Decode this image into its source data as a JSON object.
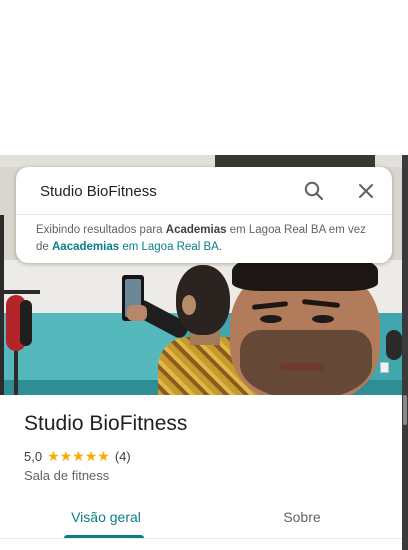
{
  "search": {
    "query": "Studio BioFitness"
  },
  "notice": {
    "prefix": "Exibindo resultados para ",
    "corrected_term": "Academias",
    "middle": " em Lagoa Real BA em vez de ",
    "original_term": "Aacademias",
    "original_suffix": " em Lagoa Real BA",
    "end": "."
  },
  "place": {
    "name": "Studio BioFitness",
    "rating": "5,0",
    "stars": "★★★★★",
    "review_count": "(4)",
    "category": "Sala de fitness"
  },
  "tabs": [
    {
      "label": "Visão geral",
      "active": true
    },
    {
      "label": "Sobre",
      "active": false
    }
  ],
  "colors": {
    "accent": "#0b7d86",
    "star": "#f9ab00"
  },
  "icons": [
    "search-icon",
    "close-icon",
    "star-icon"
  ]
}
